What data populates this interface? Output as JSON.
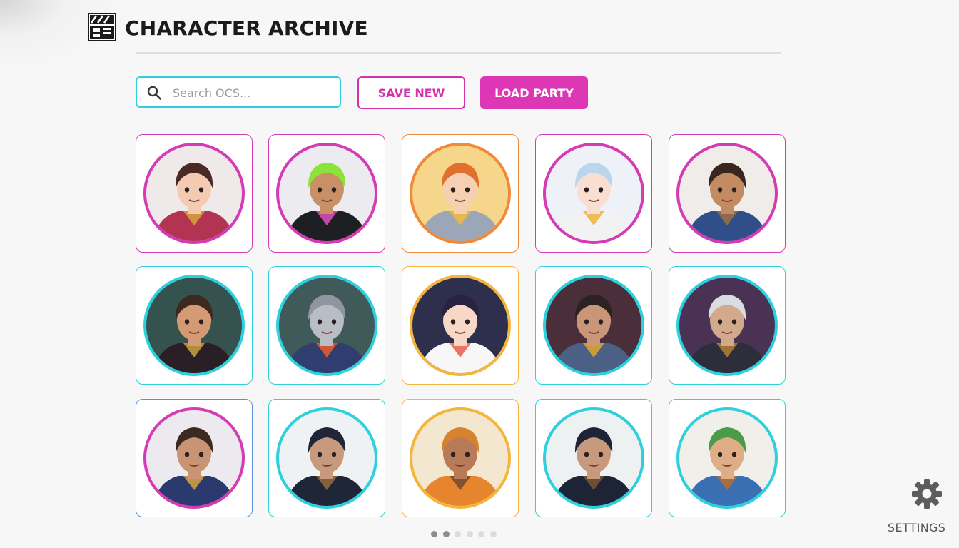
{
  "header": {
    "title": "CHARACTER ARCHIVE",
    "logo_icon": "clapperboard-icon"
  },
  "toolbar": {
    "search_placeholder": "Search OCS...",
    "search_value": "",
    "save_label": "SAVE NEW",
    "load_label": "LOAD PARTY"
  },
  "colors": {
    "accent_magenta": "#d43bb5",
    "accent_cyan": "#2dd0dc",
    "accent_orange": "#f08a3a",
    "accent_gold": "#f3b53c",
    "accent_blue": "#5a8fd6"
  },
  "characters": [
    {
      "name": "samurai-armored-girl",
      "icon": "samurai-portrait",
      "frame": "magenta",
      "ring": "magenta",
      "bg": "#efe9ea",
      "skin": "#f3cbb3",
      "hair": "#4a2a25",
      "outfit": "#b23452",
      "accent": "#d7a43a"
    },
    {
      "name": "green-mohawk-punk",
      "icon": "punk-portrait",
      "frame": "magenta",
      "ring": "magenta",
      "bg": "#ecebef",
      "skin": "#c98f66",
      "hair": "#8be33a",
      "outfit": "#1d1f22",
      "accent": "#e04fc1"
    },
    {
      "name": "fox-eared-mage",
      "icon": "fox-mage-portrait",
      "frame": "orange",
      "ring": "orange",
      "bg": "#f6d68a",
      "skin": "#f6d0b3",
      "hair": "#e0702c",
      "outfit": "#9ba7b6",
      "accent": "#f5b93a"
    },
    {
      "name": "cat-eared-rainbow-girl",
      "icon": "cat-girl-portrait",
      "frame": "magenta",
      "ring": "magenta",
      "bg": "#eef2f8",
      "skin": "#f9dfd2",
      "hair": "#b9d6ec",
      "outfit": "#f2f2f2",
      "accent": "#f0b33a"
    },
    {
      "name": "rogue-adventurer",
      "icon": "rogue-portrait",
      "frame": "magenta",
      "ring": "magenta",
      "bg": "#efecea",
      "skin": "#c28b62",
      "hair": "#3a2620",
      "outfit": "#2f4e8a",
      "accent": "#a0703e"
    },
    {
      "name": "pirate-captain",
      "icon": "pirate-portrait",
      "frame": "cyan",
      "ring": "cyan",
      "bg": "#35524f",
      "skin": "#d39a74",
      "hair": "#3d2a1e",
      "outfit": "#2a1f24",
      "accent": "#c9a23c"
    },
    {
      "name": "robot-knight",
      "icon": "robot-portrait",
      "frame": "cyan",
      "ring": "cyan",
      "bg": "#3f5a58",
      "skin": "#b9bec6",
      "hair": "#8f96a2",
      "outfit": "#2f3e6e",
      "accent": "#f05a2a"
    },
    {
      "name": "idol-girl-flower",
      "icon": "idol-portrait",
      "frame": "gold",
      "ring": "gold",
      "bg": "#2e2f4d",
      "skin": "#f7d7c6",
      "hair": "#2a2340",
      "outfit": "#f7f7f7",
      "accent": "#ea5c4c"
    },
    {
      "name": "lion-shield-knight",
      "icon": "knight-portrait",
      "frame": "cyan",
      "ring": "cyan",
      "bg": "#4a2e3a",
      "skin": "#c99778",
      "hair": "#2b2224",
      "outfit": "#4c5f84",
      "accent": "#e0a72c"
    },
    {
      "name": "silver-haired-swordsman",
      "icon": "swordsman-portrait",
      "frame": "cyan",
      "ring": "cyan",
      "bg": "#4a3255",
      "skin": "#d3a98c",
      "hair": "#d9dde3",
      "outfit": "#2c2e3a",
      "accent": "#b57f3a"
    },
    {
      "name": "bearded-scholar",
      "icon": "scholar-portrait",
      "frame": "blue",
      "ring": "magenta",
      "bg": "#eceaef",
      "skin": "#c99473",
      "hair": "#3c2a20",
      "outfit": "#2a3a6e",
      "accent": "#d7a43a"
    },
    {
      "name": "hooded-assassin",
      "icon": "assassin-portrait",
      "frame": "cyan",
      "ring": "cyan",
      "bg": "#eef2f4",
      "skin": "#c79a7d",
      "hair": "#1f2638",
      "outfit": "#1f2638",
      "accent": "#9a6b3b"
    },
    {
      "name": "desert-nomad",
      "icon": "nomad-portrait",
      "frame": "gold",
      "ring": "gold",
      "bg": "#f4e7cf",
      "skin": "#b97a58",
      "hair": "#d7822f",
      "outfit": "#e7852e",
      "accent": "#6d4a2e"
    },
    {
      "name": "masked-ninja",
      "icon": "ninja-portrait",
      "frame": "cyan",
      "ring": "cyan",
      "bg": "#eef1f2",
      "skin": "#c79a7d",
      "hair": "#1d2436",
      "outfit": "#1d2436",
      "accent": "#7b5535"
    },
    {
      "name": "goggled-tinkerer",
      "icon": "tinkerer-portrait",
      "frame": "cyan",
      "ring": "cyan",
      "bg": "#f1efe9",
      "skin": "#e0ae86",
      "hair": "#4a9b4a",
      "outfit": "#3b6fb4",
      "accent": "#b86e2e"
    }
  ],
  "pagination": {
    "pages": 6,
    "active": [
      0,
      1
    ]
  },
  "settings": {
    "label": "SETTINGS",
    "icon": "gear-icon"
  }
}
